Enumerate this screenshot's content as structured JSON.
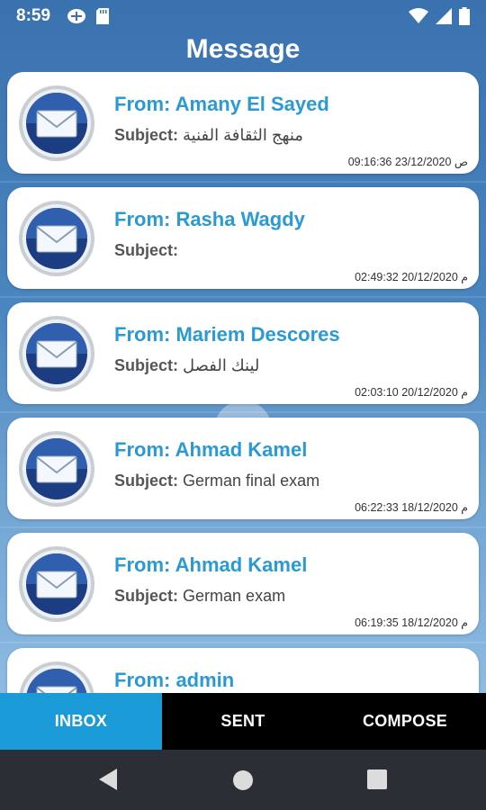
{
  "status_bar": {
    "time": "8:59",
    "left_icons": [
      "sync-icon",
      "sd-card-icon"
    ],
    "right_icons": [
      "wifi-icon",
      "signal-icon",
      "battery-icon"
    ]
  },
  "header": {
    "title": "Message"
  },
  "messages": [
    {
      "from": "From: Amany El Sayed",
      "subject_label": "Subject:",
      "subject": "منهج الثقافة الفنية",
      "date": "09:16:36 23/12/2020 ص"
    },
    {
      "from": "From: Rasha Wagdy",
      "subject_label": "Subject:",
      "subject": "",
      "date": "02:49:32 20/12/2020 م"
    },
    {
      "from": "From: Mariem Descores",
      "subject_label": "Subject:",
      "subject": "لينك الفصل",
      "date": "02:03:10 20/12/2020 م"
    },
    {
      "from": "From: Ahmad Kamel",
      "subject_label": "Subject:",
      "subject": "German final exam",
      "date": "06:22:33 18/12/2020 م"
    },
    {
      "from": "From: Ahmad Kamel",
      "subject_label": "Subject:",
      "subject": "German exam",
      "date": "06:19:35 18/12/2020 م"
    },
    {
      "from": "From: admin",
      "subject_label": "",
      "subject": "",
      "date": ""
    }
  ],
  "bottom_nav": {
    "tabs": [
      {
        "label": "INBOX",
        "active": true
      },
      {
        "label": "SENT",
        "active": false
      },
      {
        "label": "COMPOSE",
        "active": false
      }
    ]
  },
  "system_nav": {
    "icons": [
      "back-icon",
      "home-icon",
      "recents-icon"
    ]
  },
  "colors": {
    "accent": "#1a9ad6",
    "from_text": "#2a9ad4",
    "background": "#3f78b4"
  }
}
